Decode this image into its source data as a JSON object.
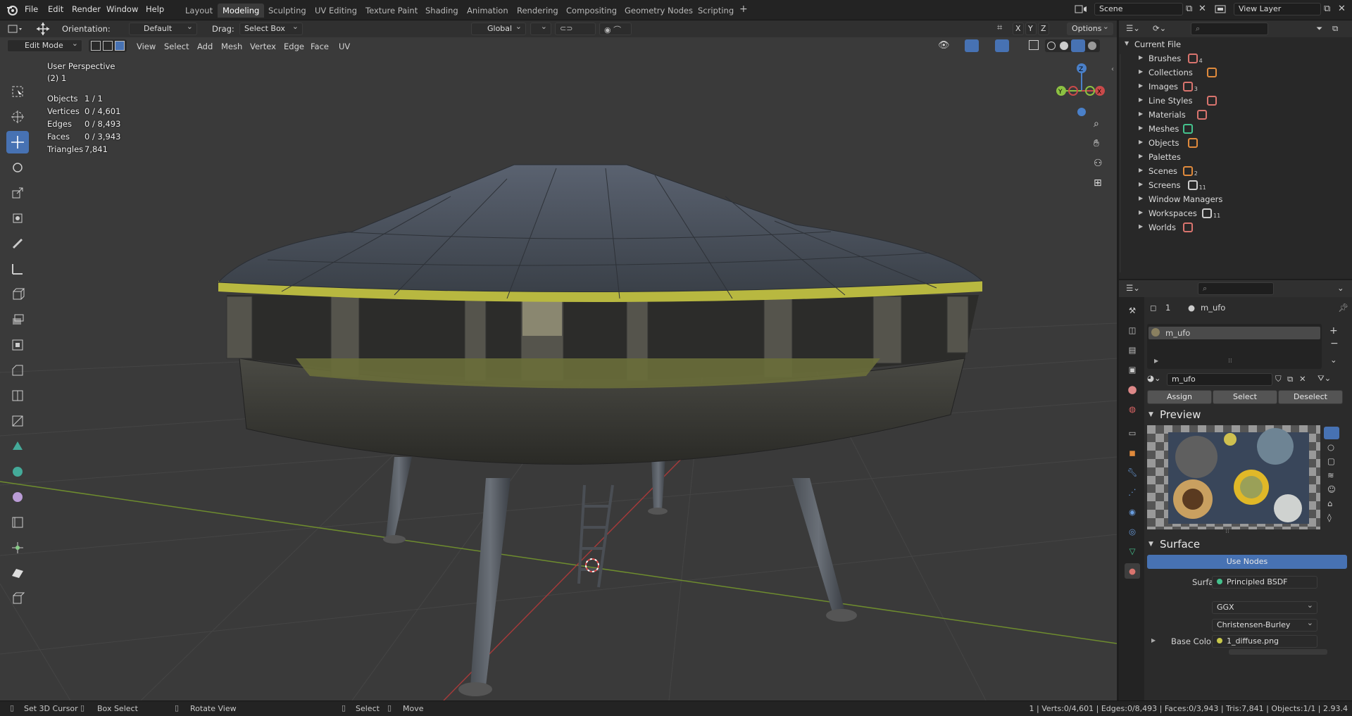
{
  "menu": {
    "file": "File",
    "edit": "Edit",
    "render": "Render",
    "window": "Window",
    "help": "Help"
  },
  "workspaces": [
    "Layout",
    "Modeling",
    "Sculpting",
    "UV Editing",
    "Texture Paint",
    "Shading",
    "Animation",
    "Rendering",
    "Compositing",
    "Geometry Nodes",
    "Scripting"
  ],
  "active_workspace": "Modeling",
  "scene": {
    "name": "Scene",
    "view_layer": "View Layer"
  },
  "tool_header": {
    "orientation_label": "Orientation:",
    "orientation_value": "Default",
    "drag_label": "Drag:",
    "drag_value": "Select Box",
    "transform": "Global",
    "options": "Options"
  },
  "viewport_header": {
    "mode": "Edit Mode",
    "menus": [
      "View",
      "Select",
      "Add",
      "Mesh",
      "Vertex",
      "Edge",
      "Face",
      "UV"
    ]
  },
  "axes": {
    "x": "X",
    "y": "Y",
    "z": "Z"
  },
  "overlay": {
    "perspective": "User Perspective",
    "collection": "(2) 1"
  },
  "stats": [
    {
      "label": "Objects",
      "value": "1 / 1"
    },
    {
      "label": "Vertices",
      "value": "0 / 4,601"
    },
    {
      "label": "Edges",
      "value": "0 / 8,493"
    },
    {
      "label": "Faces",
      "value": "0 / 3,943"
    },
    {
      "label": "Triangles",
      "value": "7,841"
    }
  ],
  "outliner": {
    "root": "Current File",
    "items": [
      {
        "label": "Brushes",
        "badge": "4",
        "color": "#d9746e"
      },
      {
        "label": "Collections",
        "badge": "",
        "color": "#e08a3c"
      },
      {
        "label": "Images",
        "badge": "3",
        "color": "#d9746e"
      },
      {
        "label": "Line Styles",
        "badge": "",
        "color": "#d9746e"
      },
      {
        "label": "Materials",
        "badge": "",
        "color": "#d9746e"
      },
      {
        "label": "Meshes",
        "badge": "",
        "color": "#44c28d"
      },
      {
        "label": "Objects",
        "badge": "",
        "color": "#e08a3c"
      },
      {
        "label": "Palettes",
        "badge": "",
        "color": ""
      },
      {
        "label": "Scenes",
        "badge": "2",
        "color": "#e08a3c"
      },
      {
        "label": "Screens",
        "badge": "11",
        "color": "#cccccc"
      },
      {
        "label": "Window Managers",
        "badge": "",
        "color": ""
      },
      {
        "label": "Workspaces",
        "badge": "11",
        "color": "#cccccc"
      },
      {
        "label": "Worlds",
        "badge": "",
        "color": "#d9746e"
      }
    ]
  },
  "properties": {
    "object_index": "1",
    "material_name": "m_ufo",
    "slot_name": "m_ufo",
    "datablock_name": "m_ufo",
    "assign": "Assign",
    "select": "Select",
    "deselect": "Deselect",
    "preview_title": "Preview",
    "surface_title": "Surface",
    "use_nodes": "Use Nodes",
    "surface_label": "Surface",
    "surface_value": "Principled BSDF",
    "distribution": "GGX",
    "subsurface_method": "Christensen-Burley",
    "base_color_label": "Base Color",
    "base_color_value": "1_diffuse.png"
  },
  "statusbar": {
    "left": [
      {
        "label": "Set 3D Cursor"
      },
      {
        "label": "Box Select"
      },
      {
        "label": "Rotate View"
      },
      {
        "label": "Select"
      },
      {
        "label": "Move"
      }
    ],
    "right": "1 | Verts:0/4,601 | Edges:0/8,493 | Faces:0/3,943 | Tris:7,841 | Objects:1/1 | 2.93.4"
  },
  "colors": {
    "accent": "#4772b3",
    "x_axis": "#c94a4a",
    "y_axis": "#8cc142",
    "z_axis": "#4a80c9",
    "ufo_band": "#c8c84a"
  }
}
